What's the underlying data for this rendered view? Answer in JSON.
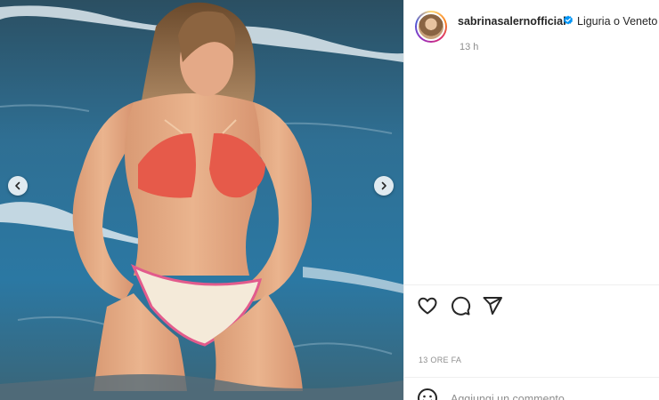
{
  "post": {
    "username": "sabrinasalernofficial",
    "location": "Liguria o Veneto",
    "time_ago": "13 h",
    "date_label": "13 ORE FA"
  },
  "comment_box": {
    "placeholder": "Aggiungi un commento..."
  },
  "icons": {
    "verified": "verified-badge-icon",
    "like": "heart-icon",
    "comment": "comment-bubble-icon",
    "share": "paper-plane-icon",
    "emoji": "emoji-smile-icon",
    "prev": "chevron-left-icon",
    "next": "chevron-right-icon"
  },
  "colors": {
    "verified_blue": "#0095f6",
    "text": "#262626",
    "secondary_text": "#8e8e8e"
  }
}
